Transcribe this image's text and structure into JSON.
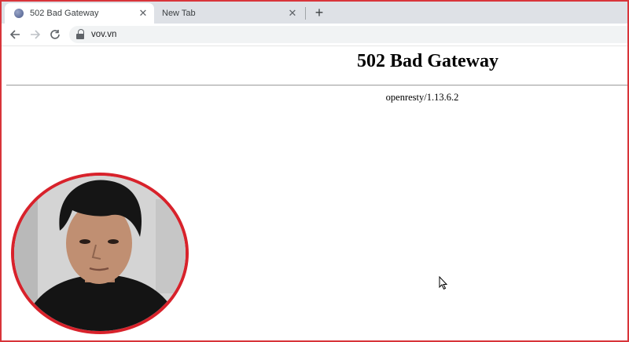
{
  "tabs": [
    {
      "title": "502 Bad Gateway",
      "active": true
    },
    {
      "title": "New Tab",
      "active": false
    }
  ],
  "toolbar": {
    "url": "vov.vn"
  },
  "page": {
    "heading": "502 Bad Gateway",
    "server": "openresty/1.13.6.2"
  },
  "colors": {
    "frame": "#d8343a",
    "tabstrip": "#dee1e6",
    "portrait_ring": "#d8222b"
  },
  "icons": {
    "favicon": "globe-icon",
    "close": "close-icon",
    "new_tab": "plus-icon",
    "back": "back-arrow-icon",
    "forward": "forward-arrow-icon",
    "reload": "reload-icon",
    "lock": "lock-icon",
    "cursor": "mouse-cursor-icon"
  }
}
